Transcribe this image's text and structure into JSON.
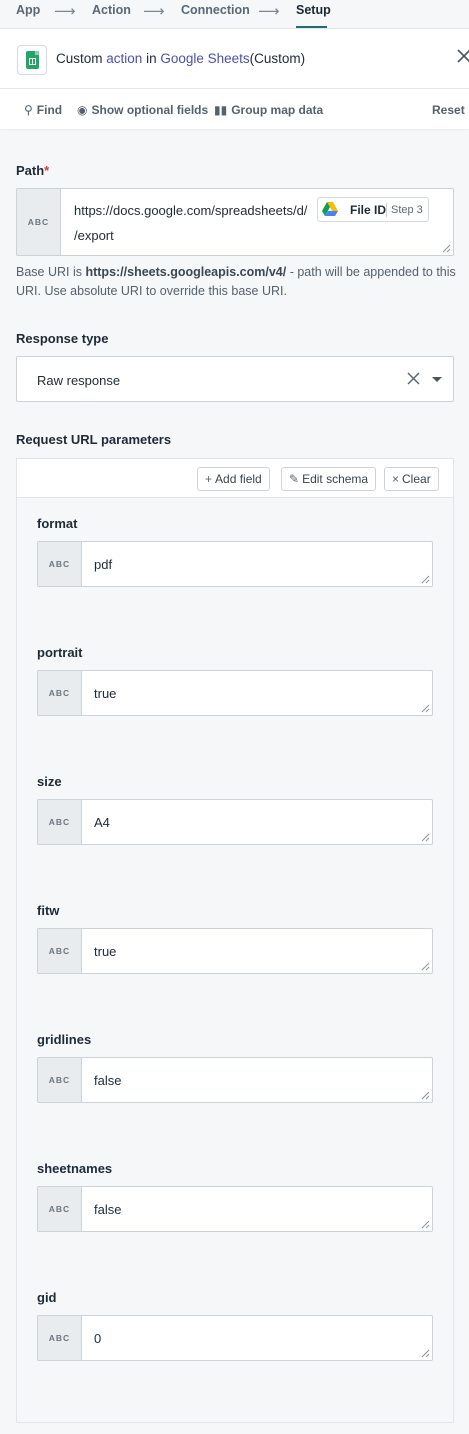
{
  "stepper": {
    "steps": [
      {
        "label": "App"
      },
      {
        "label": "Action"
      },
      {
        "label": "Connection"
      },
      {
        "label": "Setup"
      }
    ],
    "active": "Setup"
  },
  "header": {
    "prefix": "Custom",
    "action_link": "action",
    "in_text": "in",
    "app_link": "Google Sheets",
    "suffix": "(Custom)"
  },
  "toolbar": {
    "find": "Find",
    "show_optional": "Show optional fields",
    "group_map": "Group map data",
    "reset": "Reset"
  },
  "path": {
    "label": "Path",
    "required_mark": "*",
    "abc": "ABC",
    "text_before": "https://docs.google.com/spreadsheets/d/",
    "pill_label": "File ID",
    "pill_step": "Step 3",
    "text_after": "/export",
    "hint_prefix": "Base URI is ",
    "hint_uri": "https://sheets.googleapis.com/v4/",
    "hint_suffix": " - path will be appended to this URI. Use absolute URI to override this base URI."
  },
  "response_type": {
    "label": "Response type",
    "value": "Raw response"
  },
  "params": {
    "label": "Request URL parameters",
    "add_field": "Add field",
    "edit_schema": "Edit schema",
    "clear": "Clear",
    "abc": "ABC",
    "fields": [
      {
        "name": "format",
        "value": "pdf"
      },
      {
        "name": "portrait",
        "value": "true"
      },
      {
        "name": "size",
        "value": "A4"
      },
      {
        "name": "fitw",
        "value": "true"
      },
      {
        "name": "gridlines",
        "value": "false"
      },
      {
        "name": "sheetnames",
        "value": "false"
      },
      {
        "name": "gid",
        "value": "0"
      }
    ]
  },
  "colors": {
    "accent": "#1e6e6e",
    "link": "#4a4fb0",
    "sheets_green": "#23a566",
    "required": "#d93a3a"
  }
}
